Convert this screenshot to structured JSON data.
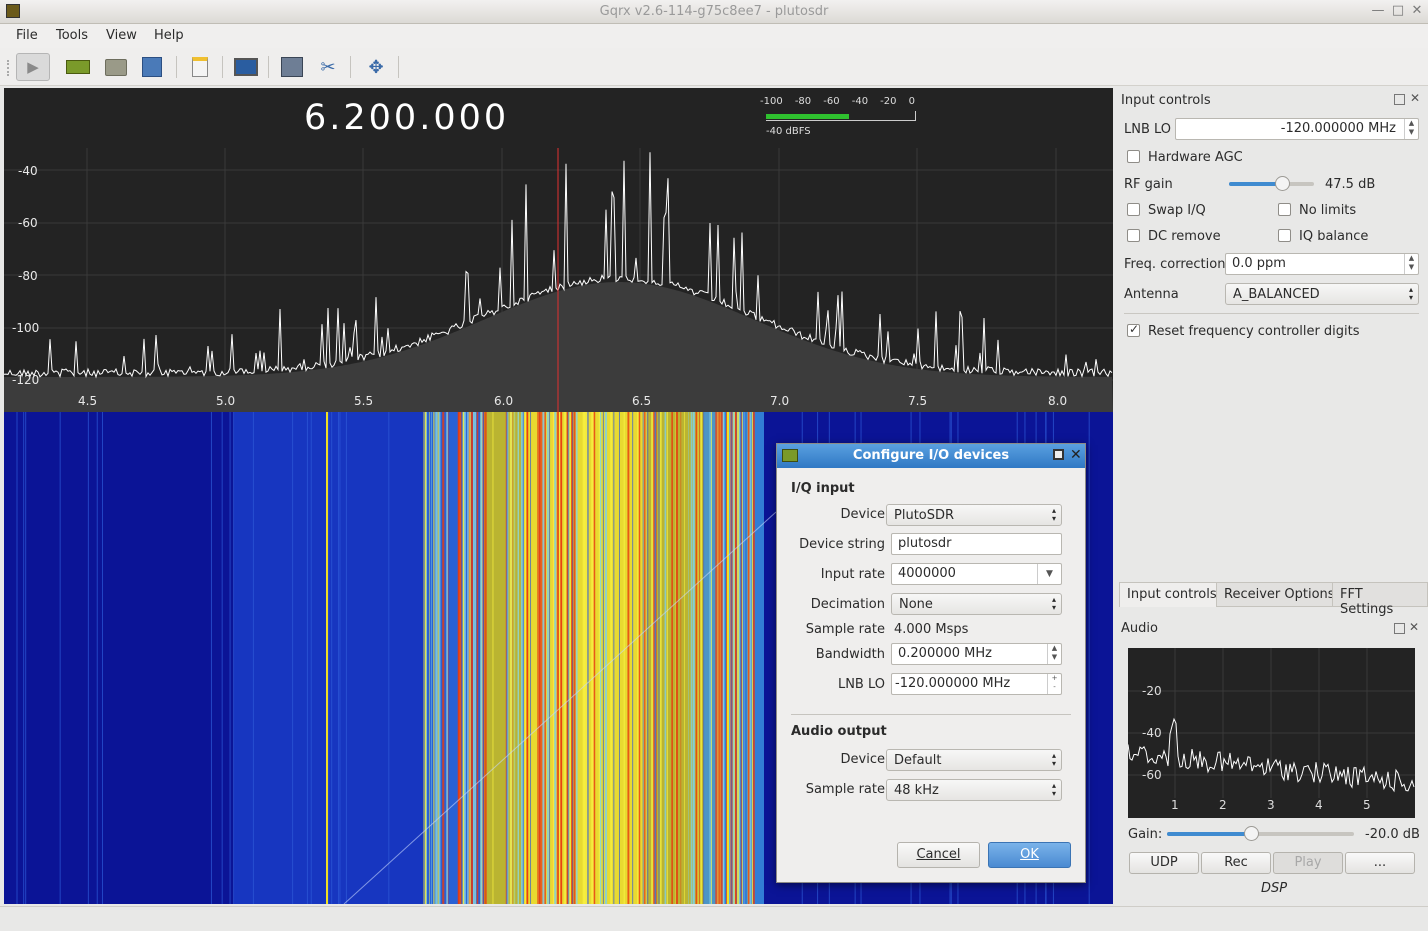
{
  "window": {
    "title": "Gqrx v2.6-114-g75c8ee7 - plutosdr"
  },
  "menu": [
    "File",
    "Tools",
    "View",
    "Help"
  ],
  "toolbar": {
    "icons": [
      "play-icon",
      "hardware-icon",
      "open-icon",
      "save-icon",
      "bookmark-icon",
      "remote-icon",
      "network-icon",
      "tools-icon",
      "fullscreen-icon"
    ]
  },
  "plot": {
    "frequency": "6.200.000",
    "y_ticks": [
      "-40",
      "-60",
      "-80",
      "-100",
      "-120"
    ],
    "x_ticks": [
      "4.5",
      "5.0",
      "5.5",
      "6.0",
      "6.5",
      "7.0",
      "7.5",
      "8.0"
    ],
    "meter_scale": [
      "-100",
      "-80",
      "-60",
      "-40",
      "-20",
      "0"
    ],
    "meter_value": "-40 dBFS",
    "meter_level": 0.55
  },
  "input_controls": {
    "title": "Input controls",
    "lnb_lo_label": "LNB LO",
    "lnb_lo_value": "-120.000000 MHz",
    "hw_agc_label": "Hardware AGC",
    "hw_agc_checked": false,
    "rf_gain_label": "RF gain",
    "rf_gain_value": "47.5 dB",
    "rf_gain_level": 0.62,
    "swap_iq_label": "Swap I/Q",
    "no_limits_label": "No limits",
    "dc_remove_label": "DC remove",
    "iq_balance_label": "IQ balance",
    "freq_corr_label": "Freq. correction",
    "freq_corr_value": "0.0 ppm",
    "antenna_label": "Antenna",
    "antenna_value": "A_BALANCED",
    "reset_label": "Reset frequency controller digits",
    "reset_checked": true
  },
  "tabs": [
    "Input controls",
    "Receiver Options",
    "FFT Settings"
  ],
  "audio": {
    "title": "Audio",
    "y_ticks": [
      "-20",
      "-40",
      "-60"
    ],
    "x_ticks": [
      "1",
      "2",
      "3",
      "4",
      "5"
    ],
    "gain_label": "Gain:",
    "gain_value": "-20.0 dB",
    "gain_level": 0.45,
    "buttons": [
      "UDP",
      "Rec",
      "Play",
      "..."
    ],
    "dsp_label": "DSP"
  },
  "dialog": {
    "title": "Configure I/O devices",
    "iq_section": "I/Q input",
    "device_label": "Device",
    "device_value": "PlutoSDR",
    "device_string_label": "Device string",
    "device_string_value": "plutosdr",
    "input_rate_label": "Input rate",
    "input_rate_value": "4000000",
    "decimation_label": "Decimation",
    "decimation_value": "None",
    "sample_rate_label": "Sample rate",
    "sample_rate_value": "4.000 Msps",
    "bandwidth_label": "Bandwidth",
    "bandwidth_value": "0.200000 MHz",
    "lnb_lo_label": "LNB LO",
    "lnb_lo_value": "-120.000000 MHz",
    "audio_section": "Audio output",
    "audio_device_label": "Device",
    "audio_device_value": "Default",
    "audio_rate_label": "Sample rate",
    "audio_rate_value": "48 kHz",
    "cancel_label": "Cancel",
    "ok_label": "OK"
  }
}
